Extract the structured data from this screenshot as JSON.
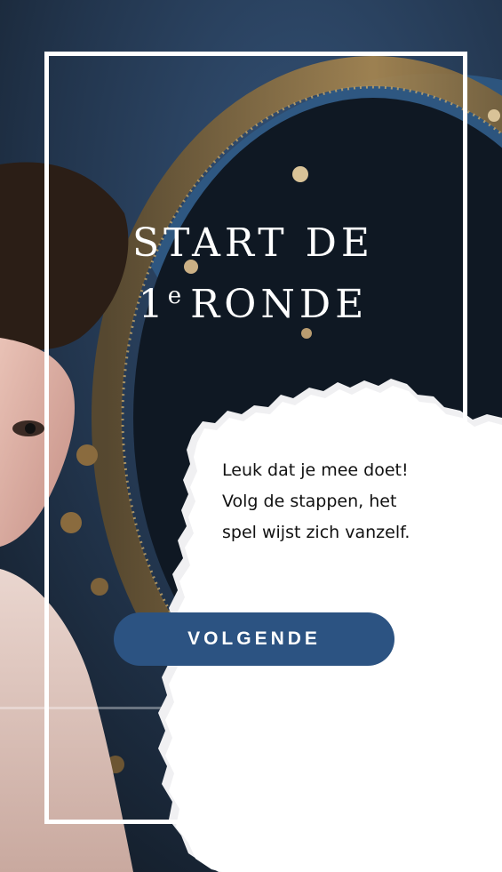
{
  "screen": {
    "headline_line1": "START DE",
    "headline_ordinal": "1",
    "headline_ordinal_suffix": "e",
    "headline_line2_rest": "RONDE",
    "message_lines": [
      "Leuk dat je mee doet!",
      "Volg de stappen, het",
      "spel wijst zich vanzelf."
    ],
    "next_button_label": "VOLGENDE"
  },
  "colors": {
    "button": "#2c5382",
    "frame": "#ffffff",
    "paper": "#ffffff",
    "text_dark": "#111111"
  }
}
